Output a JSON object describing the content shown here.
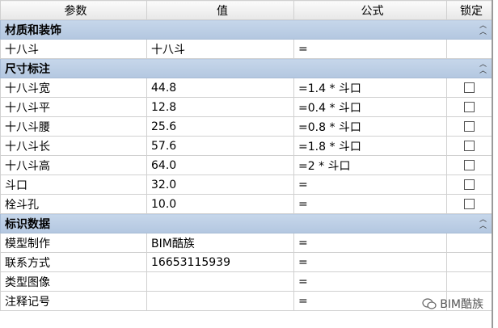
{
  "header": {
    "param": "参数",
    "value": "值",
    "formula": "公式",
    "lock": "锁定"
  },
  "groups": {
    "material": {
      "title": "材质和装饰",
      "collapse_icon": "chevron-up-double"
    },
    "dimensions": {
      "title": "尺寸标注",
      "collapse_icon": "chevron-up-double"
    },
    "identity": {
      "title": "标识数据",
      "collapse_icon": "chevron-up-double"
    }
  },
  "rows": {
    "material": [
      {
        "param": "十八斗",
        "value": "十八斗",
        "formula": "="
      }
    ],
    "dimensions": [
      {
        "param": "十八斗宽",
        "value": "44.8",
        "formula": "=1.4 * 斗口",
        "locked": false
      },
      {
        "param": "十八斗平",
        "value": "12.8",
        "formula": "=0.4 * 斗口",
        "locked": false
      },
      {
        "param": "十八斗腰",
        "value": "25.6",
        "formula": "=0.8 * 斗口",
        "locked": false
      },
      {
        "param": "十八斗长",
        "value": "57.6",
        "formula": "=1.8 * 斗口",
        "locked": false
      },
      {
        "param": "十八斗高",
        "value": "64.0",
        "formula": "=2 * 斗口",
        "locked": false
      },
      {
        "param": "斗口",
        "value": "32.0",
        "formula": "=",
        "locked": false
      },
      {
        "param": "栓斗孔",
        "value": "10.0",
        "formula": "=",
        "locked": false
      }
    ],
    "identity": [
      {
        "param": "模型制作",
        "value": "BIM酷族",
        "formula": "="
      },
      {
        "param": "联系方式",
        "value": "16653115939",
        "formula": "="
      },
      {
        "param": "类型图像",
        "value": "",
        "formula": "="
      },
      {
        "param": "注释记号",
        "value": "",
        "formula": "="
      }
    ]
  },
  "watermark": {
    "text": "BIM酷族",
    "icon": "wechat-icon"
  }
}
